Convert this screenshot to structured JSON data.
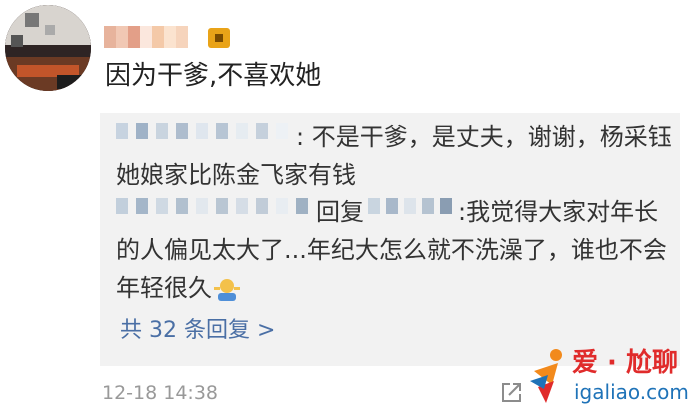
{
  "comment": {
    "text": "因为干爹,不喜欢她",
    "timestamp": "12-18 14:38"
  },
  "replies": [
    {
      "text": ": 不是干爹，是丈夫，谢谢，杨采钰她娘家比陈金飞家有钱"
    },
    {
      "reply_word": "回复",
      "text_tail": ":我觉得大家对年长的人偏见太大了...年纪大怎么就不洗澡了，谁也不会年轻很久"
    }
  ],
  "more_replies_label": "共 32 条回复 >",
  "watermark": {
    "text_cn": "爱 · 尬聊",
    "text_en": "igaliao.com"
  },
  "colors": {
    "link": "#4a6fa5",
    "panel_bg": "#f2f2f2",
    "timestamp": "#999999",
    "badge": "#e9a318"
  }
}
